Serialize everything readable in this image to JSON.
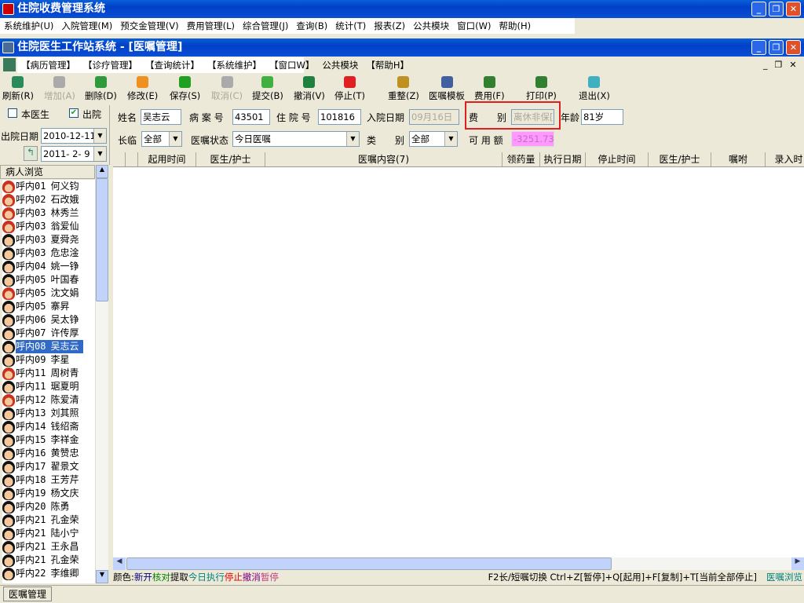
{
  "app": {
    "title": "住院收费管理系统",
    "menu": [
      "系统维护(U)",
      "入院管理(M)",
      "预交金管理(V)",
      "费用管理(L)",
      "综合管理(J)",
      "查询(B)",
      "统计(T)",
      "报表(Z)",
      "公共模块",
      "窗口(W)",
      "帮助(H)"
    ]
  },
  "child": {
    "title": "住院医生工作站系统 - [医嘱管理]",
    "menu": [
      "【病历管理】",
      "【诊疗管理】",
      "【查询统计】",
      "【系统维护】",
      "【窗口W】",
      "公共模块",
      "【帮助H】"
    ]
  },
  "toolbar": [
    {
      "label": "刷新(R)",
      "icon": "refresh-icon",
      "enabled": true,
      "color": "#2a8a5a"
    },
    {
      "label": "增加(A)",
      "icon": "add-icon",
      "enabled": false,
      "color": "#aaaaaa"
    },
    {
      "label": "删除(D)",
      "icon": "delete-icon",
      "enabled": true,
      "color": "#2f9a3a"
    },
    {
      "label": "修改(E)",
      "icon": "edit-icon",
      "enabled": true,
      "color": "#f09020"
    },
    {
      "label": "保存(S)",
      "icon": "save-icon",
      "enabled": true,
      "color": "#20a020"
    },
    {
      "label": "取消(C)",
      "icon": "cancel-icon",
      "enabled": false,
      "color": "#aaaaaa"
    },
    {
      "label": "提交(B)",
      "icon": "submit-icon",
      "enabled": true,
      "color": "#40b040"
    },
    {
      "label": "撤消(V)",
      "icon": "undo-icon",
      "enabled": true,
      "color": "#208040"
    },
    {
      "label": "停止(T)",
      "icon": "stop-icon",
      "enabled": true,
      "color": "#e02020"
    },
    {
      "label": "重整(Z)",
      "icon": "reorganize-icon",
      "enabled": true,
      "color": "#c09020"
    },
    {
      "label": "医嘱模板",
      "icon": "template-icon",
      "enabled": true,
      "color": "#4060a0"
    },
    {
      "label": "费用(F)",
      "icon": "fee-icon",
      "enabled": true,
      "color": "#308030"
    },
    {
      "label": "打印(P)",
      "icon": "print-icon",
      "enabled": true,
      "color": "#308030"
    },
    {
      "label": "退出(X)",
      "icon": "exit-icon",
      "enabled": true,
      "color": "#40b0c0"
    }
  ],
  "filter": {
    "my_doctor_label": "本医生",
    "my_doctor_checked": false,
    "discharged_label": "出院",
    "discharged_checked": true,
    "discharge_date_label": "出院日期",
    "date_from": "2010-12-11",
    "date_to": "2011- 2- 9",
    "list_header": "病人浏览"
  },
  "patient": {
    "name_label": "姓名",
    "name": "吴志云",
    "record_label": "病 案 号",
    "record_no": "43501",
    "inpatient_label": "住 院 号",
    "inpatient_no": "101816",
    "admit_label": "入院日期",
    "admit_date": "09月16日",
    "fee_type_label": "费　　别",
    "fee_type": "离休非保[",
    "age_label": "年龄",
    "age": "81岁",
    "term_label": "长临",
    "term": "全部",
    "status_label": "医嘱状态",
    "status": "今日医嘱",
    "category_label": "类　　别",
    "category": "全部",
    "balance_label": "可 用 额",
    "balance": "-3251.73"
  },
  "table": {
    "columns": [
      "",
      "",
      "起用时间",
      "医生/护士",
      "医嘱内容(7)",
      "领药量",
      "执行日期",
      "停止时间",
      "医生/护士",
      "嘱咐",
      "录入时"
    ]
  },
  "patients": [
    {
      "ward": "呼内01",
      "name": "何义钧",
      "g": "f"
    },
    {
      "ward": "呼内02",
      "name": "石改娥",
      "g": "f"
    },
    {
      "ward": "呼内03",
      "name": "林秀兰",
      "g": "f"
    },
    {
      "ward": "呼内03",
      "name": "翁爱仙",
      "g": "f"
    },
    {
      "ward": "呼内03",
      "name": "夏舜尧",
      "g": "m"
    },
    {
      "ward": "呼内03",
      "name": "危忠淦",
      "g": "m"
    },
    {
      "ward": "呼内04",
      "name": "姚一铮",
      "g": "m"
    },
    {
      "ward": "呼内05",
      "name": "叶国春",
      "g": "m"
    },
    {
      "ward": "呼内05",
      "name": "沈文娟",
      "g": "f"
    },
    {
      "ward": "呼内05",
      "name": "寨昇",
      "g": "m"
    },
    {
      "ward": "呼内06",
      "name": "吴太铮",
      "g": "m"
    },
    {
      "ward": "呼内07",
      "name": "许传厚",
      "g": "m"
    },
    {
      "ward": "呼内08",
      "name": "吴志云",
      "g": "m",
      "selected": true
    },
    {
      "ward": "呼内09",
      "name": "李星",
      "g": "m"
    },
    {
      "ward": "呼内11",
      "name": "周树青",
      "g": "f"
    },
    {
      "ward": "呼内11",
      "name": "琚夏明",
      "g": "m"
    },
    {
      "ward": "呼内12",
      "name": "陈爱清",
      "g": "f"
    },
    {
      "ward": "呼内13",
      "name": "刘其照",
      "g": "m"
    },
    {
      "ward": "呼内14",
      "name": "钱绍斋",
      "g": "m"
    },
    {
      "ward": "呼内15",
      "name": "李祥金",
      "g": "m"
    },
    {
      "ward": "呼内16",
      "name": "黄赞忠",
      "g": "m"
    },
    {
      "ward": "呼内17",
      "name": "翟景文",
      "g": "m"
    },
    {
      "ward": "呼内18",
      "name": "王芳芹",
      "g": "m"
    },
    {
      "ward": "呼内19",
      "name": "杨文庆",
      "g": "m"
    },
    {
      "ward": "呼内20",
      "name": "陈勇",
      "g": "m"
    },
    {
      "ward": "呼内21",
      "name": "孔金荣",
      "g": "m"
    },
    {
      "ward": "呼内21",
      "name": "陆小宁",
      "g": "m"
    },
    {
      "ward": "呼内21",
      "name": "王永昌",
      "g": "m"
    },
    {
      "ward": "呼内21",
      "name": "孔金荣",
      "g": "m"
    },
    {
      "ward": "呼内22",
      "name": "李维卿",
      "g": "m"
    }
  ],
  "legend": {
    "prefix": "颜色:",
    "items": [
      {
        "text": "新开",
        "color": "#000080"
      },
      {
        "text": "核对",
        "color": "#008000"
      },
      {
        "text": "提取",
        "color": "#000000"
      },
      {
        "text": "今日执行",
        "color": "#008080"
      },
      {
        "text": "停止",
        "color": "#e00000"
      },
      {
        "text": "撤消",
        "color": "#800080"
      },
      {
        "text": "暂停",
        "color": "#c04080"
      }
    ],
    "hint": "F2长/短嘱切换 Ctrl+Z[暂停]+Q[起用]+F[复制]+T[当前全部停止]",
    "browse": "医嘱浏览"
  },
  "taskbar": {
    "tab": "医嘱管理"
  },
  "highlight_color": "#e02020"
}
